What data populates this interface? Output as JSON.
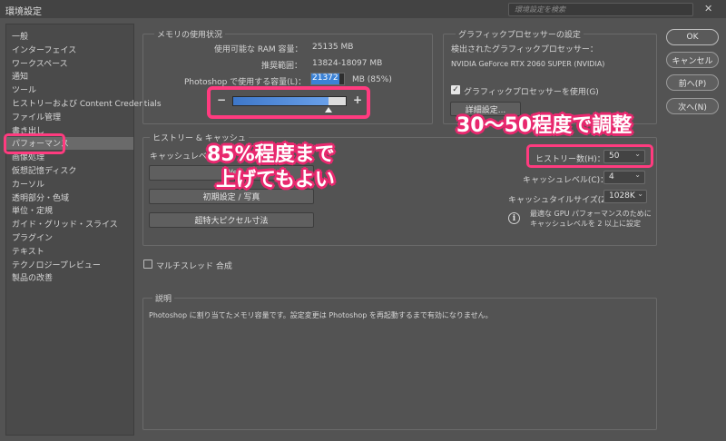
{
  "window": {
    "title": "環境設定",
    "search_placeholder": "環境設定を検索",
    "close_glyph": "✕"
  },
  "sidebar": {
    "items": [
      {
        "label": "一般"
      },
      {
        "label": "インターフェイス"
      },
      {
        "label": "ワークスペース"
      },
      {
        "label": "通知"
      },
      {
        "label": "ツール"
      },
      {
        "label": "ヒストリーおよび Content Credentials"
      },
      {
        "label": "ファイル管理"
      },
      {
        "label": "書き出し"
      },
      {
        "label": "パフォーマンス",
        "selected": true
      },
      {
        "label": "画像処理"
      },
      {
        "label": "仮想記憶ディスク"
      },
      {
        "label": "カーソル"
      },
      {
        "label": "透明部分・色域"
      },
      {
        "label": "単位・定規"
      },
      {
        "label": "ガイド・グリッド・スライス"
      },
      {
        "label": "プラグイン"
      },
      {
        "label": "テキスト"
      },
      {
        "label": "テクノロジープレビュー"
      },
      {
        "label": "製品の改善"
      }
    ]
  },
  "memory": {
    "legend": "メモリの使用状況",
    "ram_label": "使用可能な RAM 容量：",
    "ram_value": "25135 MB",
    "range_label": "推奨範囲：",
    "range_value": "13824-18097 MB",
    "use_label": "Photoshop で使用する容量(L)：",
    "use_value": "21372",
    "use_suffix": "MB (85%)",
    "slider_fraction": 0.85,
    "minus": "−",
    "plus": "+"
  },
  "gpu": {
    "legend": "グラフィックプロセッサーの設定",
    "detected_label": "検出されたグラフィックプロセッサー：",
    "gpu_name": "NVIDIA GeForce RTX 2060 SUPER (NVIDIA)",
    "use_gpu_label": "グラフィックプロセッサーを使用(G)",
    "use_gpu_checked": true,
    "advanced_button": "詳細設定..."
  },
  "history": {
    "legend": "ヒストリー & キャッシュ",
    "cache_level_label_left": "キャッシュレベル",
    "preset_web": "We",
    "preset_default": "初期設定 / 写真",
    "preset_huge": "超特大ピクセル寸法",
    "history_states_label": "ヒストリー数(H)：",
    "history_states_value": "50",
    "cache_levels_label": "キャッシュレベル(C)：",
    "cache_levels_value": "4",
    "tile_size_label": "キャッシュタイルサイズ(Z)：",
    "tile_size_value": "1028K",
    "info_glyph": "i",
    "info_text_1": "最適な GPU パフォーマンスのために",
    "info_text_2": "キャッシュレベルを 2 以上に設定",
    "chevron": "⌄"
  },
  "multithread": {
    "label": "マルチスレッド 合成",
    "checked": false
  },
  "description": {
    "legend": "説明",
    "text": "Photoshop に割り当てたメモリ容量です。設定変更は Photoshop を再起動するまで有効になりません。"
  },
  "buttons": {
    "ok": "OK",
    "cancel": "キャンセル",
    "prev": "前へ(P)",
    "next": "次へ(N)"
  },
  "annotations": {
    "memory_note_1": "85%程度まで",
    "memory_note_2": "上げてもよい",
    "history_note": "30～50程度で調整"
  },
  "colors": {
    "background": "#535353",
    "accent_pink": "#ff3b7f",
    "selection_blue": "#3b82d6"
  }
}
